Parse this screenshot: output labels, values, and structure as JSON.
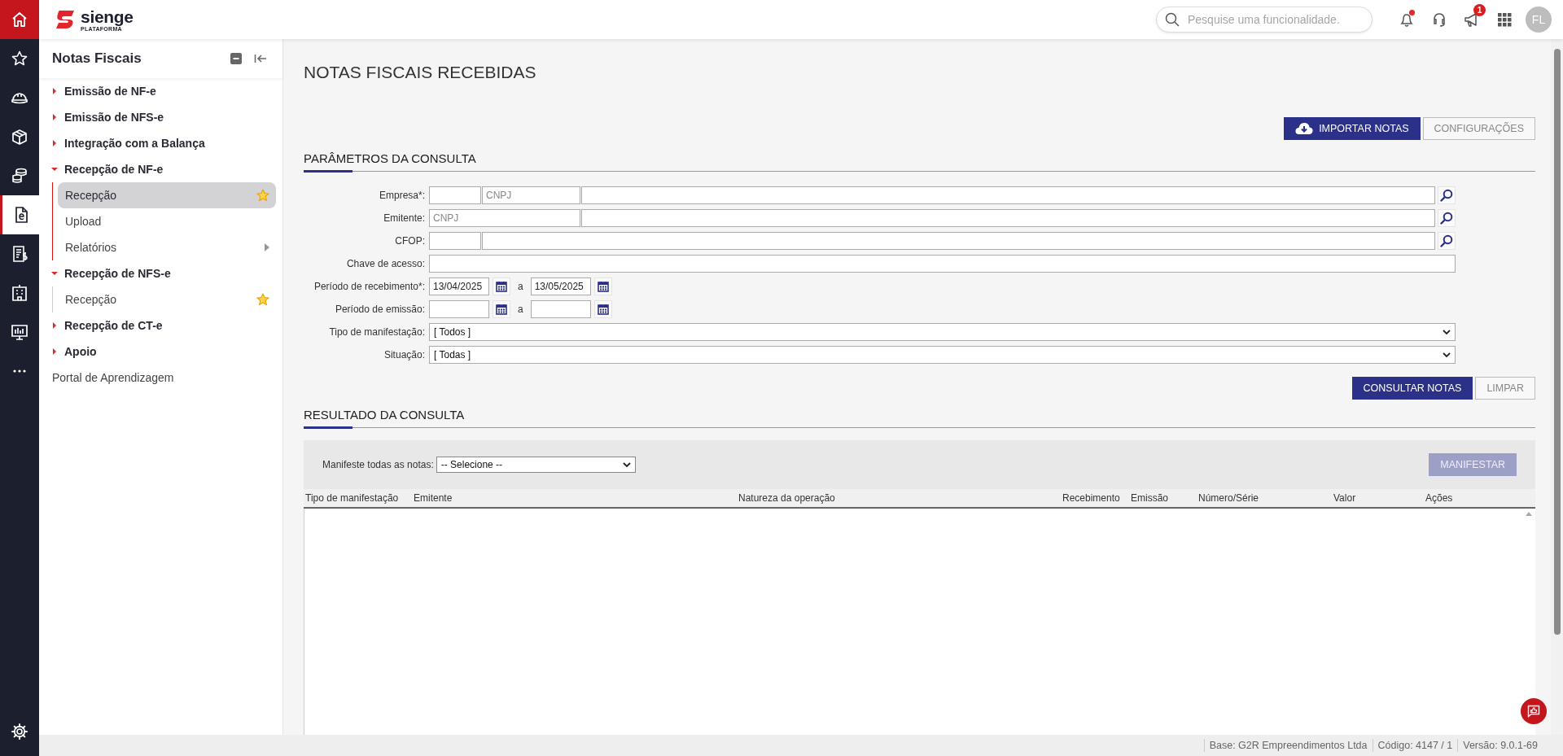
{
  "rail": {
    "items": [
      {
        "kind": "home",
        "selected": false
      },
      {
        "kind": "favorites",
        "selected": false
      },
      {
        "kind": "construction",
        "selected": false
      },
      {
        "kind": "supplies",
        "selected": false
      },
      {
        "kind": "finance",
        "selected": false
      },
      {
        "kind": "fiscal",
        "selected": true
      },
      {
        "kind": "billing",
        "selected": false
      },
      {
        "kind": "buildings",
        "selected": false
      },
      {
        "kind": "dashboard",
        "selected": false
      },
      {
        "kind": "more",
        "selected": false
      },
      {
        "kind": "settings",
        "selected": false
      }
    ]
  },
  "header": {
    "logo": {
      "name": "sienge",
      "tagline": "PLATAFORMA"
    },
    "search": {
      "placeholder": "Pesquise uma funcionalidade."
    },
    "notifications": {
      "unread": true
    },
    "announcements": {
      "badge": "1"
    },
    "avatar": "FL"
  },
  "sidebar": {
    "title": "Notas Fiscais",
    "items": [
      {
        "label": "Emissão de NF-e",
        "kind": "group",
        "expanded": false
      },
      {
        "label": "Emissão de NFS-e",
        "kind": "group",
        "expanded": false
      },
      {
        "label": "Integração com a Balança",
        "kind": "group",
        "expanded": false
      },
      {
        "label": "Recepção de NF-e",
        "kind": "group",
        "expanded": true,
        "children": [
          {
            "label": "Recepção",
            "selected": true,
            "favorite": true,
            "submenu": false
          },
          {
            "label": "Upload",
            "selected": false,
            "favorite": false,
            "submenu": false
          },
          {
            "label": "Relatórios",
            "selected": false,
            "favorite": false,
            "submenu": true
          }
        ]
      },
      {
        "label": "Recepção de NFS-e",
        "kind": "group",
        "expanded": true,
        "children": [
          {
            "label": "Recepção",
            "selected": false,
            "favorite": true,
            "submenu": false
          }
        ]
      },
      {
        "label": "Recepção de CT-e",
        "kind": "group",
        "expanded": false
      },
      {
        "label": "Apoio",
        "kind": "group",
        "expanded": false
      },
      {
        "label": "Portal de Aprendizagem",
        "kind": "link"
      }
    ]
  },
  "page": {
    "title": "NOTAS FISCAIS RECEBIDAS",
    "actions": [
      {
        "label": "IMPORTAR NOTAS",
        "kind": "primary",
        "with_icon": true
      },
      {
        "label": "CONFIGURAÇÕES",
        "kind": "secondary"
      }
    ]
  },
  "query": {
    "heading": "PARÂMETROS DA CONSULTA",
    "fields": [
      {
        "kind": "company",
        "label": "Empresa*:",
        "cnpj_placeholder": "CNPJ"
      },
      {
        "kind": "issuer",
        "label": "Emitente:",
        "cnpj_placeholder": "CNPJ"
      },
      {
        "kind": "code",
        "label": "CFOP:"
      },
      {
        "kind": "text",
        "label": "Chave de acesso:"
      },
      {
        "kind": "period",
        "label": "Período de recebimento*:",
        "from": "13/04/2025",
        "separator": "a",
        "to": "13/05/2025"
      },
      {
        "kind": "period",
        "label": "Período de emissão:",
        "separator": "a"
      },
      {
        "kind": "select",
        "label": "Tipo de manifestação:",
        "value": "[ Todos ]"
      },
      {
        "kind": "select",
        "label": "Situação:",
        "value": "[ Todas ]"
      }
    ],
    "buttons": [
      {
        "label": "CONSULTAR NOTAS",
        "kind": "primary"
      },
      {
        "label": "LIMPAR",
        "kind": "secondary"
      }
    ]
  },
  "results": {
    "heading": "RESULTADO DA CONSULTA",
    "bulk": {
      "label": "Manifeste todas as notas:",
      "value": "-- Selecione --"
    },
    "action": {
      "label": "MANIFESTAR",
      "disabled": true
    },
    "table": {
      "columns": [
        "Tipo de manifestação",
        "Emitente",
        "Natureza da operação",
        "Recebimento",
        "Emissão",
        "Número/Série",
        "Valor",
        "Ações"
      ]
    }
  },
  "status_bar": [
    "Base: G2R Empreendimentos Ltda",
    "Código: 4147 / 1",
    "Versão: 9.0.1-69"
  ]
}
